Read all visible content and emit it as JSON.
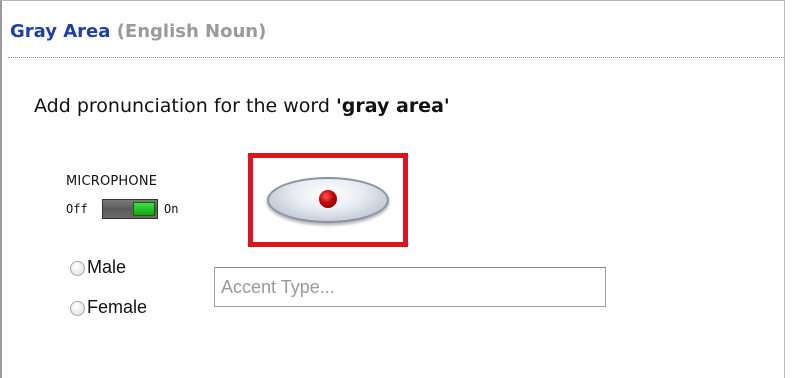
{
  "header": {
    "word": "Gray Area",
    "part_of_speech": "(English Noun)"
  },
  "prompt": {
    "text": "Add pronunciation for the word ",
    "word_quoted": "'gray area'"
  },
  "microphone": {
    "label": "MICROPHONE",
    "off_label": "Off",
    "on_label": "On",
    "state": "on"
  },
  "record_button": {
    "icon": "record-icon",
    "highlight_color": "#e0141c"
  },
  "gender": {
    "options": [
      "Male",
      "Female"
    ],
    "selected": null
  },
  "accent": {
    "placeholder": "Accent Type...",
    "value": ""
  },
  "colors": {
    "word_link": "#1f3fa8",
    "part_of_speech": "#9a9a9a"
  }
}
